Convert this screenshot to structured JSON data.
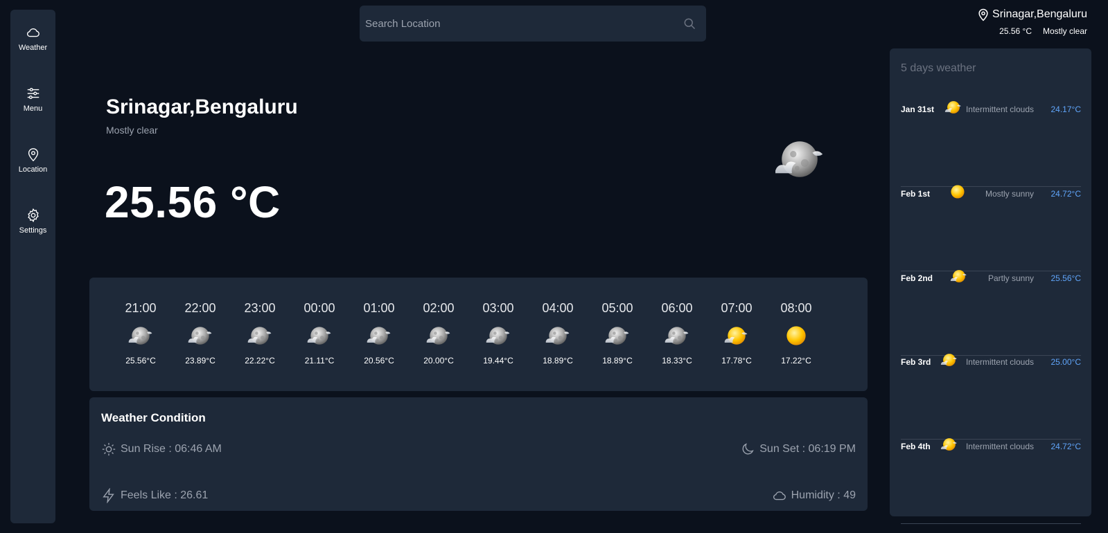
{
  "sidebar": {
    "items": [
      {
        "label": "Weather",
        "icon": "cloud-icon"
      },
      {
        "label": "Menu",
        "icon": "sliders-icon"
      },
      {
        "label": "Location",
        "icon": "map-pin-icon"
      },
      {
        "label": "Settings",
        "icon": "gear-icon"
      }
    ]
  },
  "search": {
    "placeholder": "Search Location"
  },
  "header": {
    "location": "Srinagar,Bengaluru",
    "temp": "25.56 °C",
    "condition": "Mostly clear"
  },
  "current": {
    "city": "Srinagar,Bengaluru",
    "condition": "Mostly clear",
    "temp": "25.56 °C",
    "icon": "moon-cloud-icon"
  },
  "hourly": [
    {
      "time": "21:00",
      "temp": "25.56°C",
      "icon": "moon-cloud-icon"
    },
    {
      "time": "22:00",
      "temp": "23.89°C",
      "icon": "moon-cloud-icon"
    },
    {
      "time": "23:00",
      "temp": "22.22°C",
      "icon": "moon-cloud-icon"
    },
    {
      "time": "00:00",
      "temp": "21.11°C",
      "icon": "moon-cloud-icon"
    },
    {
      "time": "01:00",
      "temp": "20.56°C",
      "icon": "moon-cloud-icon"
    },
    {
      "time": "02:00",
      "temp": "20.00°C",
      "icon": "moon-cloud-icon"
    },
    {
      "time": "03:00",
      "temp": "19.44°C",
      "icon": "moon-cloud-icon"
    },
    {
      "time": "04:00",
      "temp": "18.89°C",
      "icon": "moon-cloud-icon"
    },
    {
      "time": "05:00",
      "temp": "18.89°C",
      "icon": "moon-cloud-icon"
    },
    {
      "time": "06:00",
      "temp": "18.33°C",
      "icon": "moon-cloud-icon"
    },
    {
      "time": "07:00",
      "temp": "17.78°C",
      "icon": "sun-cloud-icon"
    },
    {
      "time": "08:00",
      "temp": "17.22°C",
      "icon": "sun-icon"
    }
  ],
  "condition": {
    "title": "Weather Condition",
    "sunrise": "Sun Rise : 06:46 AM",
    "sunset": "Sun Set : 06:19 PM",
    "feels_like": "Feels Like : 26.61",
    "humidity": "Humidity : 49"
  },
  "forecast": {
    "title": "5 days weather",
    "days": [
      {
        "date": "Jan 31st",
        "desc": "Intermittent clouds",
        "temp": "24.17°C",
        "icon": "sun-cloud-icon"
      },
      {
        "date": "Feb 1st",
        "desc": "Mostly sunny",
        "temp": "24.72°C",
        "icon": "sun-icon"
      },
      {
        "date": "Feb 2nd",
        "desc": "Partly sunny",
        "temp": "25.56°C",
        "icon": "sun-cloud-icon"
      },
      {
        "date": "Feb 3rd",
        "desc": "Intermittent clouds",
        "temp": "25.00°C",
        "icon": "sun-cloud-icon"
      },
      {
        "date": "Feb 4th",
        "desc": "Intermittent clouds",
        "temp": "24.72°C",
        "icon": "sun-cloud-icon"
      }
    ]
  },
  "colors": {
    "background": "#0b111c",
    "panel": "#1e2939",
    "muted_text": "#9ca3af",
    "accent_temp": "#60a5fa"
  }
}
